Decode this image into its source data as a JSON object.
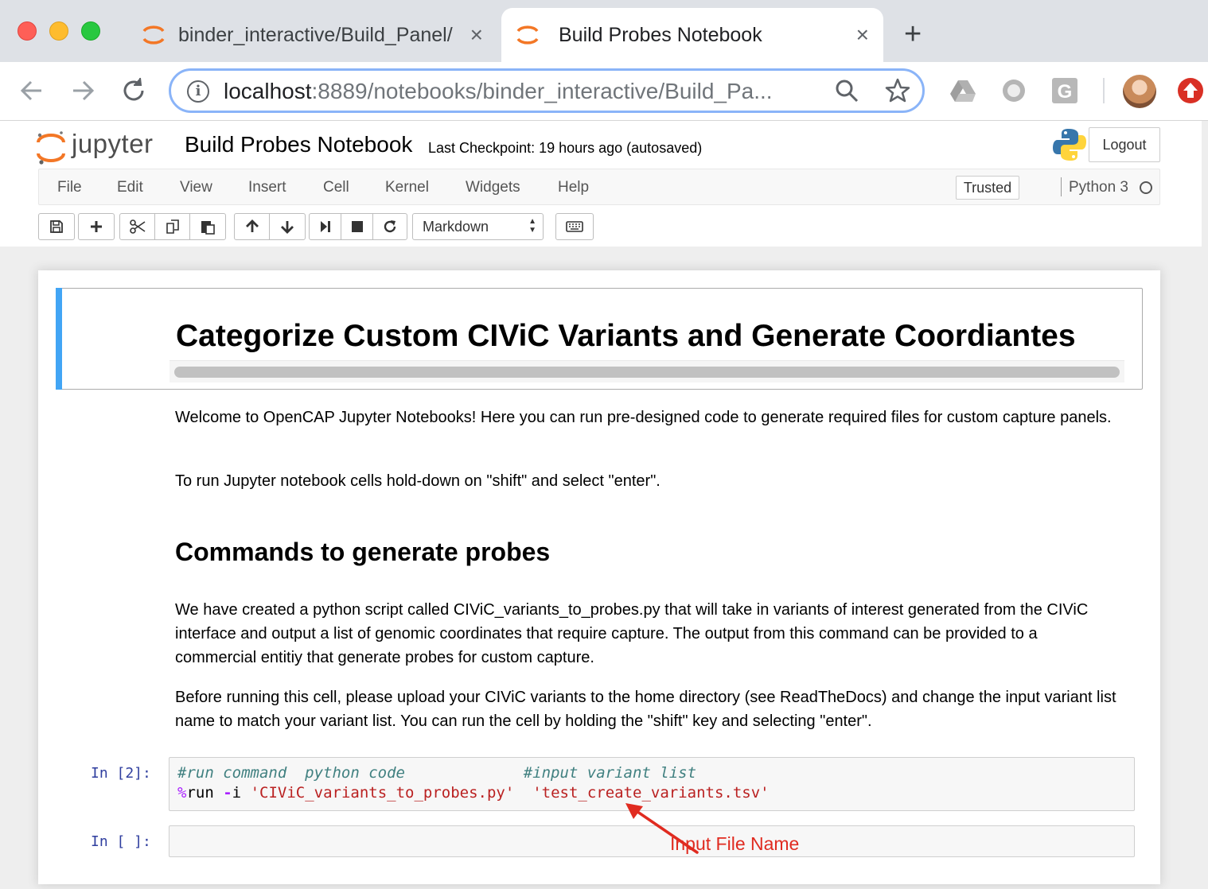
{
  "browser": {
    "tabs": [
      {
        "title": "binder_interactive/Build_Panel/",
        "active": false
      },
      {
        "title": "Build Probes Notebook",
        "active": true
      }
    ],
    "new_tab_label": "+",
    "close_glyph": "×",
    "url_host": "localhost",
    "url_rest": ":8889/notebooks/binder_interactive/Build_Pa...",
    "extensions": [
      "google-drive-icon",
      "loom-icon",
      "grammarly-icon"
    ],
    "accent_color": "#8ab4f8"
  },
  "jupyter": {
    "logo_text": "jupyter",
    "notebook_title": "Build Probes Notebook",
    "checkpoint": "Last Checkpoint: 19 hours ago (autosaved)",
    "logout_label": "Logout",
    "menu": [
      "File",
      "Edit",
      "View",
      "Insert",
      "Cell",
      "Kernel",
      "Widgets",
      "Help"
    ],
    "trusted_label": "Trusted",
    "kernel_name": "Python 3",
    "cell_type": "Markdown"
  },
  "notebook": {
    "heading": "Categorize Custom CIViC Variants and Generate Coordiantes",
    "intro_1": "Welcome to OpenCAP Jupyter Notebooks! Here you can run pre-designed code to generate required files for custom capture panels.",
    "intro_2": "To run Jupyter notebook cells hold-down on \"shift\" and select \"enter\".",
    "subheading": "Commands to generate probes",
    "para_1": "We have created a python script called CIViC_variants_to_probes.py that will take in variants of interest generated from the CIViC interface and output a list of genomic coordinates that require capture. The output from this command can be provided to a commercial entitiy that generate probes for custom capture.",
    "para_2": "Before running this cell, please upload your CIViC variants to the home directory (see ReadTheDocs) and change the input variant list name to match your variant list. You can run the cell by holding the \"shift\" key and selecting \"enter\".",
    "code_cell_1": {
      "prompt": "In [2]:",
      "line1_comment1": "#run command  python code",
      "line1_comment2": "#input variant list",
      "line2_magic": "%",
      "line2_cmd": "run ",
      "line2_flag": "-",
      "line2_i": "i ",
      "line2_script": "'CIViC_variants_to_probes.py'",
      "line2_file": "'test_create_variants.tsv'"
    },
    "code_cell_2": {
      "prompt": "In [ ]:"
    },
    "annotation": "Input File Name",
    "annotation_color": "#e02b20",
    "selection_color": "#42a5f5"
  }
}
